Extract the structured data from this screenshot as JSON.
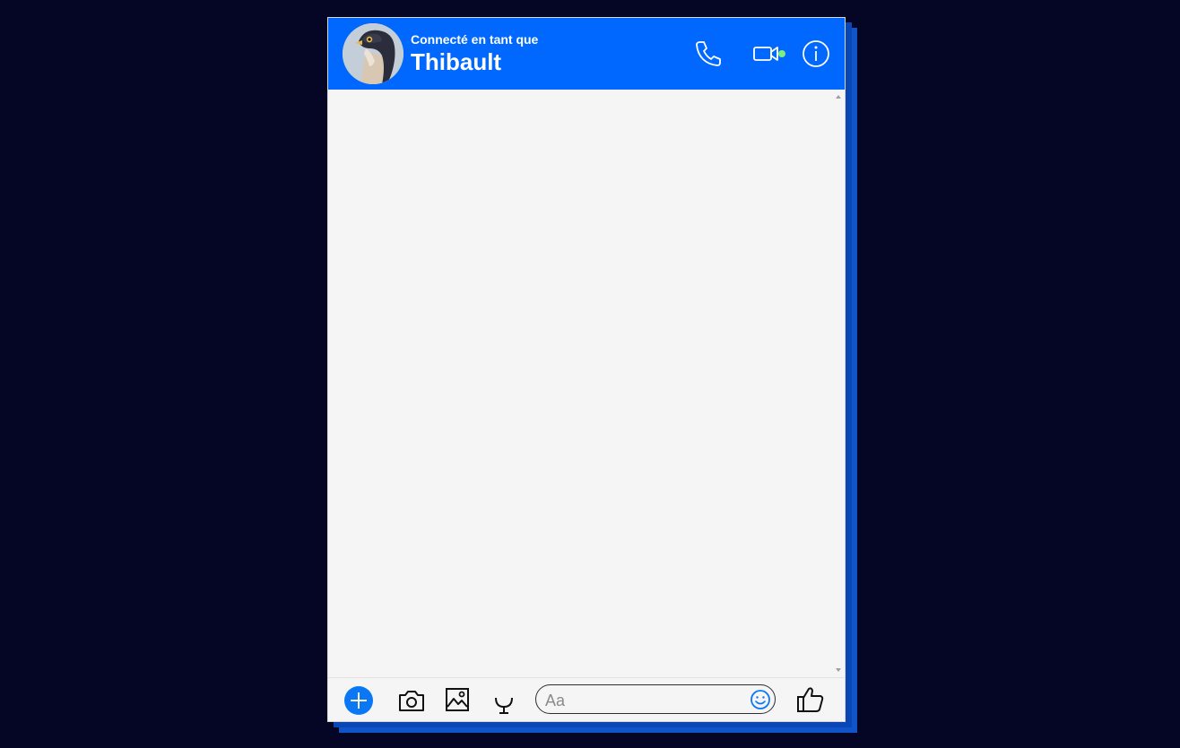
{
  "header": {
    "subtitle": "Connecté en tant que",
    "username": "Thibault",
    "status": "online"
  },
  "icons": {
    "call": "phone-icon",
    "video": "video-camera-icon",
    "info": "info-icon",
    "add": "plus-icon",
    "camera": "camera-icon",
    "image": "image-icon",
    "audio": "microphone-icon",
    "emoji": "smiley-icon",
    "like": "thumbs-up-icon"
  },
  "composer": {
    "placeholder": "Aa",
    "value": ""
  },
  "colors": {
    "brand": "#0068ff",
    "online": "#7cf07c",
    "background": "#050526",
    "accent": "#0a78f5"
  }
}
